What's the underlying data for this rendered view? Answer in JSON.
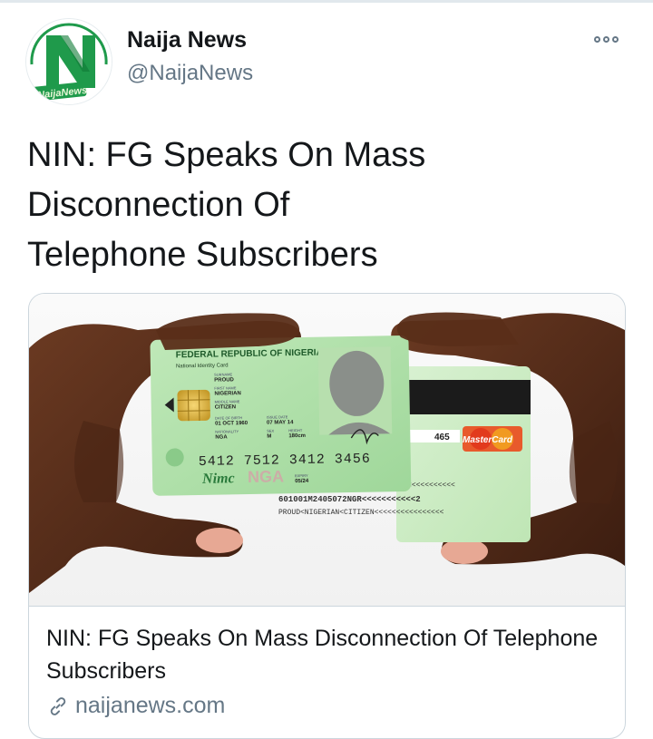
{
  "account": {
    "name": "Naija News",
    "handle": "@NaijaNews",
    "avatar_logo_text": "NaijaNews",
    "brand_green": "#1f9a4b"
  },
  "tweet": {
    "text_line1": "NIN: FG Speaks On Mass",
    "text_line2": "Disconnection Of",
    "text_line3": "Telephone Subscribers"
  },
  "card": {
    "title": "NIN: FG Speaks On Mass Disconnection Of Telephone Subscribers",
    "domain": "naijanews.com",
    "image": {
      "front": {
        "header": "FEDERAL REPUBLIC OF NIGERIA",
        "subheader": "National Identity Card",
        "surname_label": "SURNAME",
        "surname": "PROUD",
        "first_name_label": "FIRST NAME",
        "first_name": "NIGERIAN",
        "middle_name_label": "MIDDLE NAME",
        "middle_name": "CITIZEN",
        "dob_label": "DATE OF BIRTH",
        "dob": "01 OCT 1960",
        "issue_label": "ISSUE DATE",
        "issue": "07 MAY 14",
        "nationality_label": "NATIONALITY",
        "nationality": "NGA",
        "sex_label": "SEX",
        "sex": "M",
        "height_label": "HEIGHT",
        "height": "180cm",
        "number": "5412 7512 3412 3456",
        "nimc": "Nimc",
        "nga_watermark": "NGA",
        "expiry_label": "EXPIRY",
        "expiry": "05/24"
      },
      "back": {
        "cvv": "465",
        "brand": "MasterCard",
        "mrz_line1": "5412753456 :<<<<<<<<<<<<<<",
        "mrz_line2": "601001M2405072NGR<<<<<<<<<<<2",
        "mrz_line3": "PROUD<NIGERIAN<CITIZEN<<<<<<<<<<<<<<<<"
      }
    }
  },
  "colors": {
    "text_primary": "#14171a",
    "text_secondary": "#657786",
    "border": "#ccd6dd",
    "card_green": "#a8dca5"
  }
}
